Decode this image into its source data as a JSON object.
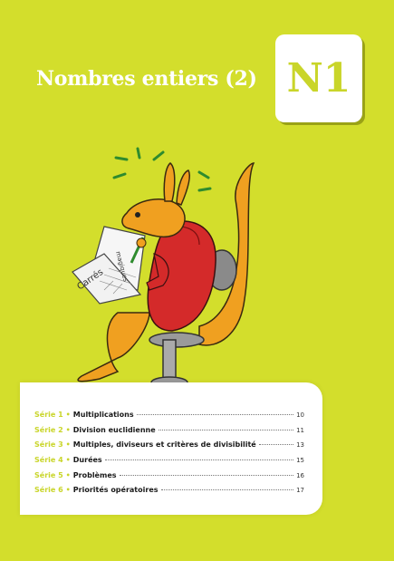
{
  "header": {
    "title": "Nombres entiers (2)",
    "badge_label": "N1"
  },
  "illustration": {
    "newspaper_text_1": "Carrés",
    "newspaper_text_2": "magiques"
  },
  "toc": {
    "items": [
      {
        "serie": "Série 1",
        "bullet": "•",
        "topic": "Multiplications",
        "page": "10"
      },
      {
        "serie": "Série 2",
        "bullet": "•",
        "topic": "Division euclidienne",
        "page": "11"
      },
      {
        "serie": "Série 3",
        "bullet": "•",
        "topic": "Multiples, diviseurs et critères de divisibilité",
        "page": "13"
      },
      {
        "serie": "Série 4",
        "bullet": "•",
        "topic": "Durées",
        "page": "15"
      },
      {
        "serie": "Série 5",
        "bullet": "•",
        "topic": "Problèmes",
        "page": "16"
      },
      {
        "serie": "Série 6",
        "bullet": "•",
        "topic": "Priorités opératoires",
        "page": "17"
      }
    ]
  },
  "colors": {
    "background": "#d3de2c",
    "accent": "#c9d52a",
    "hoodie": "#d42a2a",
    "kangaroo": "#f0a020"
  }
}
